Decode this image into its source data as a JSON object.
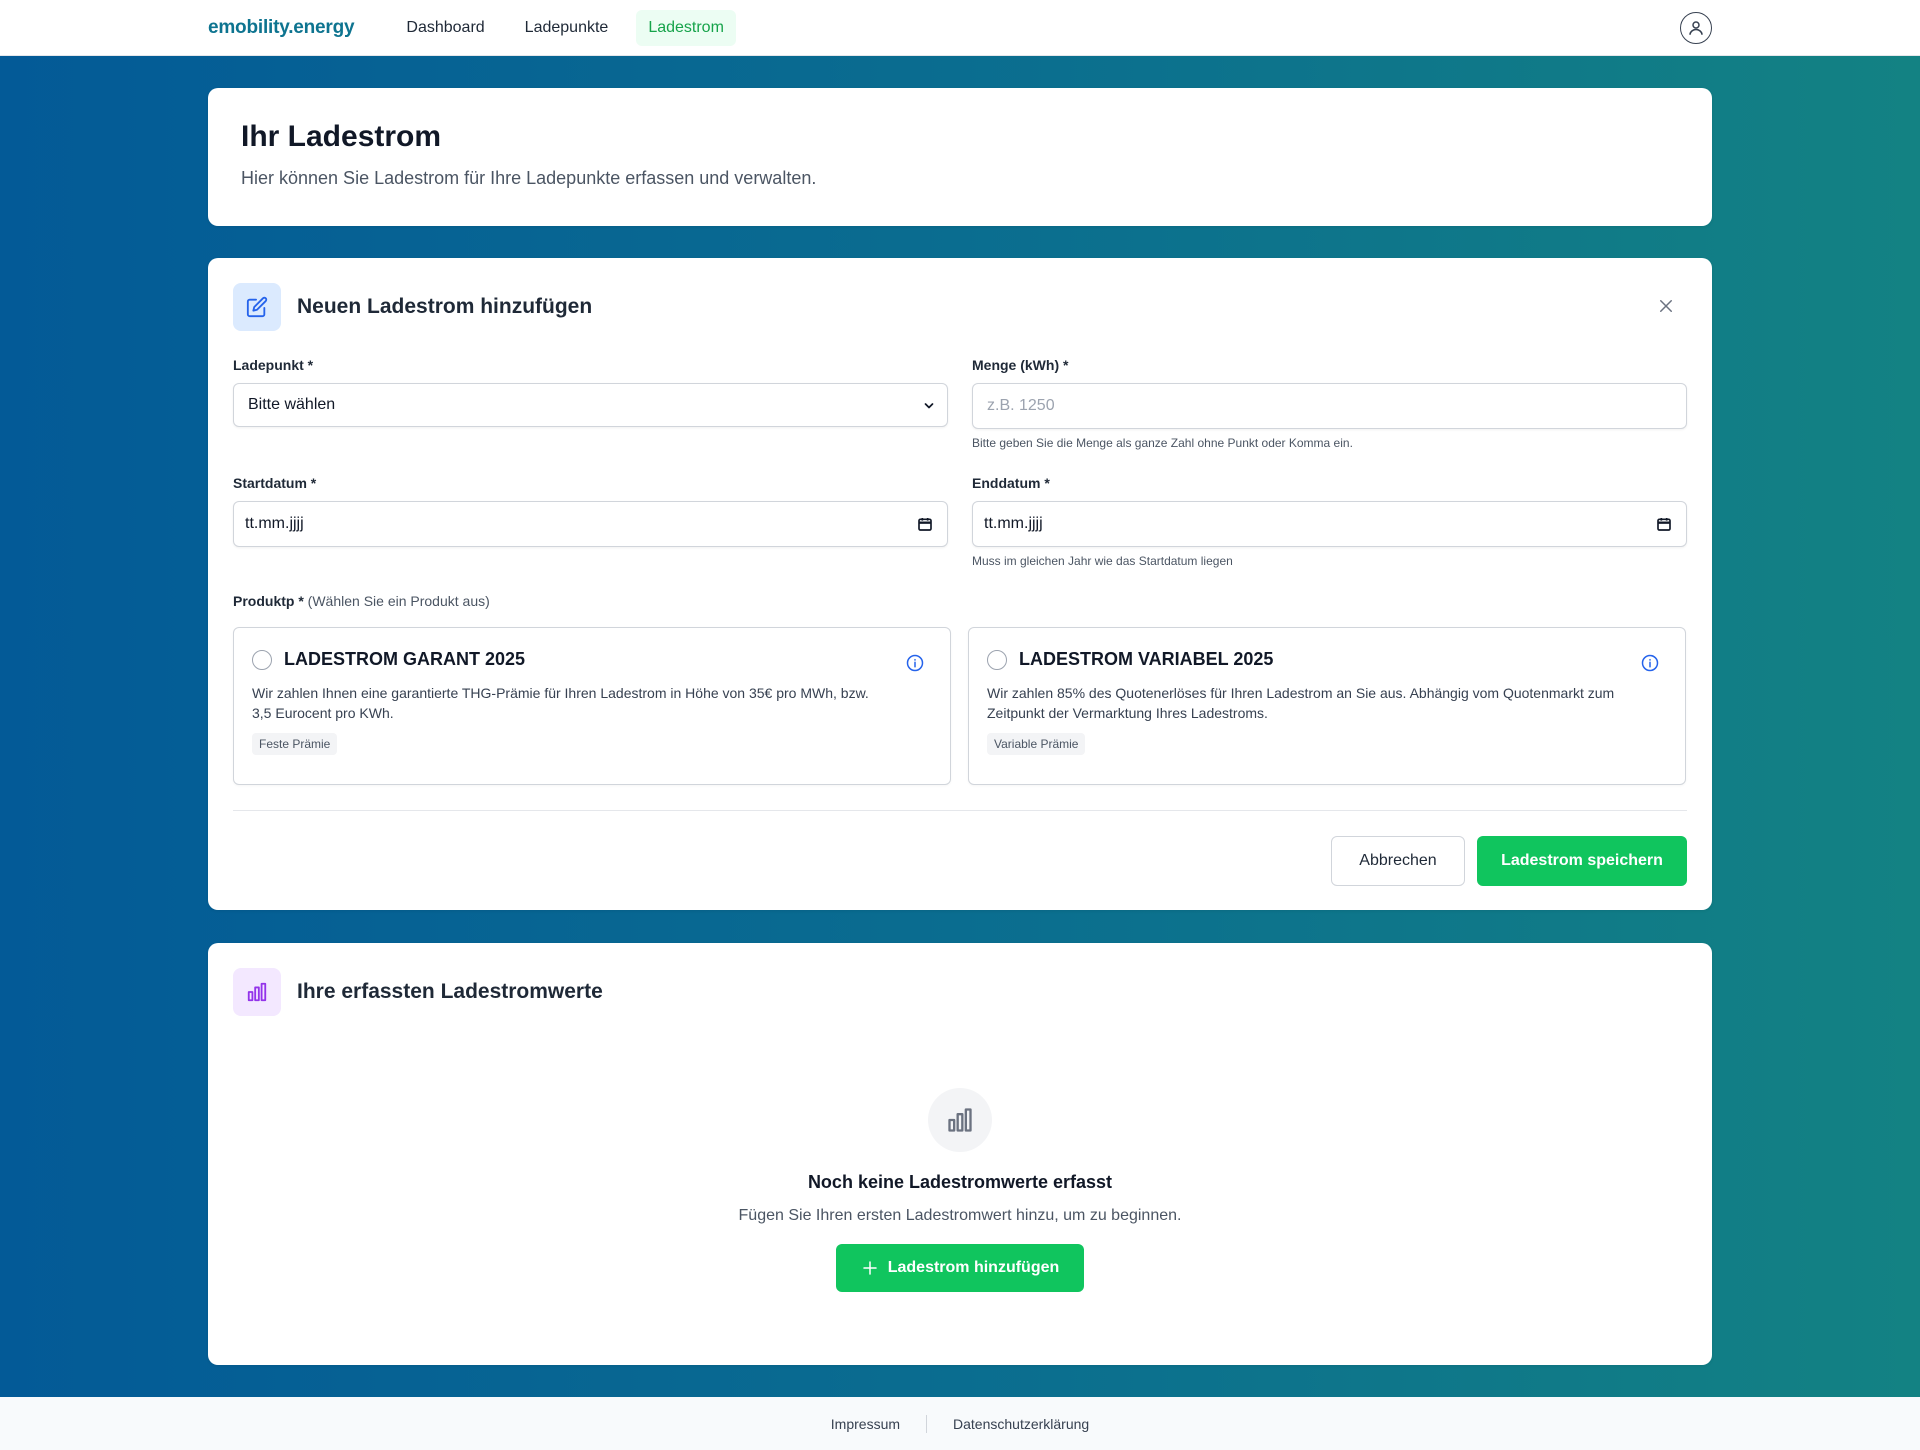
{
  "header": {
    "brand": "emobility.energy",
    "nav": [
      {
        "label": "Dashboard",
        "active": false
      },
      {
        "label": "Ladepunkte",
        "active": false
      },
      {
        "label": "Ladestrom",
        "active": true
      }
    ],
    "accent_color": "#16a34a"
  },
  "intro": {
    "title": "Ihr Ladestrom",
    "subtitle": "Hier können Sie Ladestrom für Ihre Ladepunkte erfassen und verwalten."
  },
  "form": {
    "title": "Neuen Ladestrom hinzufügen",
    "ladepunkt": {
      "label": "Ladepunkt *",
      "value": "Bitte wählen"
    },
    "menge": {
      "label": "Menge (kWh) *",
      "placeholder": "z.B. 1250",
      "help": "Bitte geben Sie die Menge als ganze Zahl ohne Punkt oder Komma ein."
    },
    "startdatum": {
      "label": "Startdatum *",
      "value": "tt.mm.jjjj"
    },
    "enddatum": {
      "label": "Enddatum *",
      "value": "tt.mm.jjjj",
      "help": "Muss im gleichen Jahr wie das Startdatum liegen"
    },
    "produkt": {
      "label": "Produktp *",
      "hint": "(Wählen Sie ein Produkt aus)",
      "options": [
        {
          "title": "LADESTROM GARANT 2025",
          "description": "Wir zahlen Ihnen eine garantierte THG-Prämie für Ihren Ladestrom in Höhe von 35€ pro MWh, bzw. 3,5 Eurocent pro KWh.",
          "badge": "Feste Prämie"
        },
        {
          "title": "LADESTROM VARIABEL 2025",
          "description": "Wir zahlen 85% des Quotenerlöses für Ihren Ladestrom an Sie aus. Abhängig vom Quotenmarkt zum Zeitpunkt der Vermarktung Ihres Ladestroms.",
          "badge": "Variable Prämie"
        }
      ]
    },
    "cancel_label": "Abbrechen",
    "save_label": "Ladestrom speichern"
  },
  "list": {
    "title": "Ihre erfassten Ladestromwerte",
    "empty_title": "Noch keine Ladestromwerte erfasst",
    "empty_subtitle": "Fügen Sie Ihren ersten Ladestromwert hinzu, um zu beginnen.",
    "add_label": "Ladestrom hinzufügen"
  },
  "footer": {
    "impressum": "Impressum",
    "datenschutz": "Datenschutzerklärung"
  }
}
